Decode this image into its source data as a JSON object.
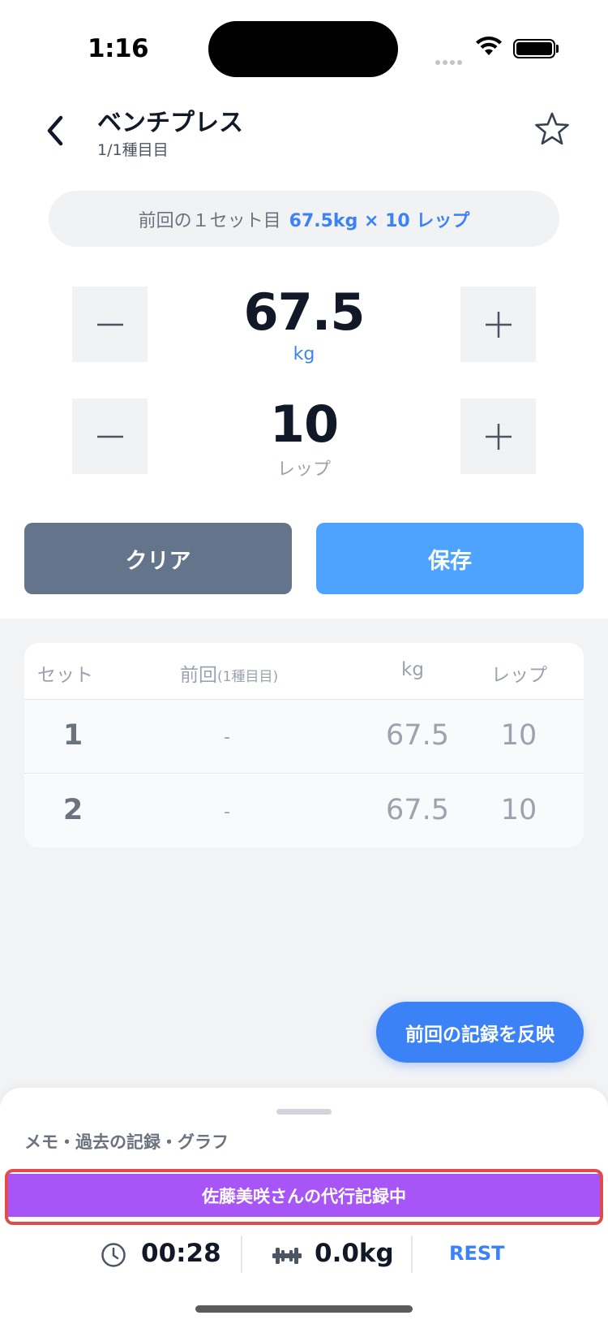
{
  "status_bar": {
    "time": "1:16"
  },
  "header": {
    "title": "ベンチプレス",
    "subtitle": "1/1種目目"
  },
  "previous": {
    "label": "前回の１セット目",
    "value": "67.5kg × 10 レップ"
  },
  "weight": {
    "value": "67.5",
    "unit": "kg",
    "minus": "−",
    "plus": "+"
  },
  "reps": {
    "value": "10",
    "unit": "レップ",
    "minus": "−",
    "plus": "+"
  },
  "actions": {
    "clear": "クリア",
    "save": "保存"
  },
  "table": {
    "headers": {
      "set": "セット",
      "prev": "前回",
      "prev_sub": "(1種目目)",
      "kg": "kg",
      "reps": "レップ"
    },
    "rows": [
      {
        "set": "1",
        "prev": "-",
        "kg": "67.5",
        "reps": "10"
      },
      {
        "set": "2",
        "prev": "-",
        "kg": "67.5",
        "reps": "10"
      }
    ]
  },
  "fab": {
    "label": "前回の記録を反映"
  },
  "sheet": {
    "label": "メモ・過去の記録・グラフ"
  },
  "proxy_banner": {
    "text": "佐藤美咲さんの代行記録中"
  },
  "bottom_bar": {
    "timer": "00:28",
    "volume": "0.0kg",
    "rest": "REST"
  },
  "colors": {
    "accent": "#3b82f6",
    "save": "#4da3ff",
    "clear": "#64748b",
    "proxy": "#a855f7",
    "highlight": "#e24b4b"
  },
  "icons": [
    "chevron-left-icon",
    "star-icon",
    "clock-icon",
    "dumbbell-icon",
    "wifi-icon",
    "battery-icon"
  ]
}
